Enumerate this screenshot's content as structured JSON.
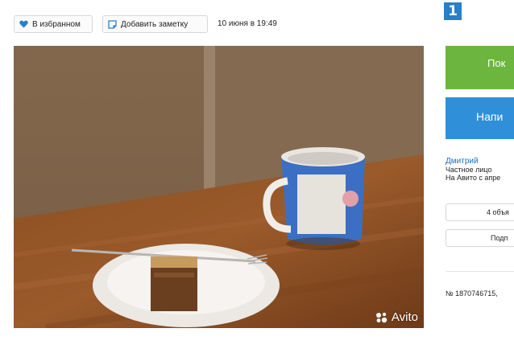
{
  "toolbar": {
    "favorite_label": "В избранном",
    "note_label": "Добавить заметку",
    "date": "10 июня в 19:49"
  },
  "figure_badge": "1",
  "photo": {
    "watermark": "Avito"
  },
  "sidebar": {
    "green_button": "Пок",
    "green_sub": "",
    "blue_button": "Напи",
    "seller_name": "Дмитрий",
    "seller_type": "Частное лицо",
    "seller_since": "На Авито с апре",
    "ads_button": "4 объя",
    "subscribe_button": "Подп",
    "ad_number": "№ 1870746715,"
  },
  "colors": {
    "green": "#6cb63f",
    "blue": "#2f8fd9",
    "heart": "#2a7fc9",
    "link": "#1d6ec7"
  }
}
